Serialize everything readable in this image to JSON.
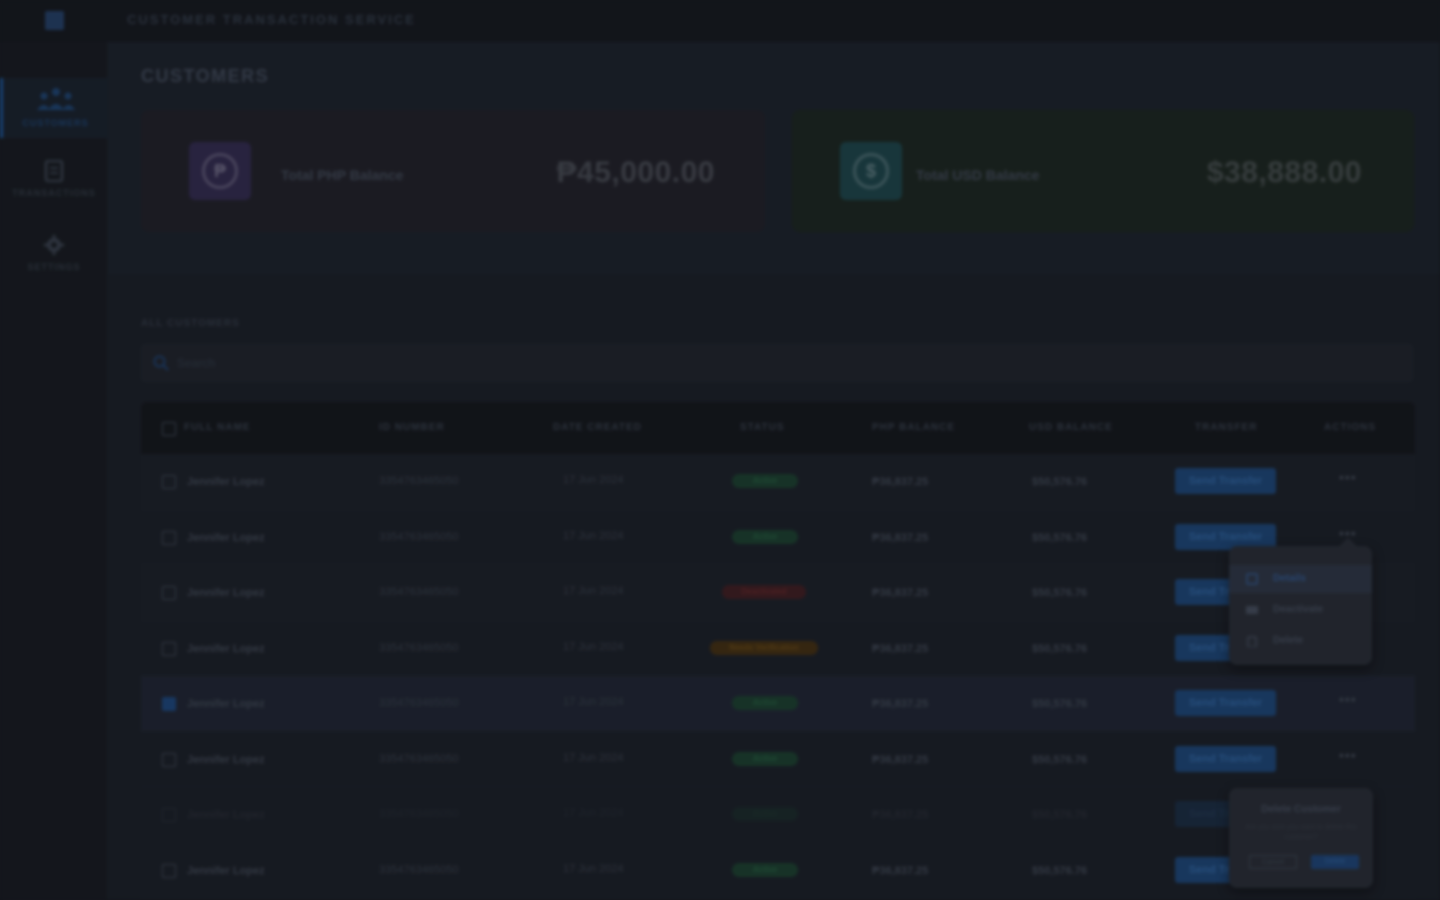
{
  "app": {
    "title": "CUSTOMER TRANSACTION SERVICE"
  },
  "sidebar": {
    "items": [
      {
        "label": "CUSTOMERS",
        "icon": "users-icon",
        "active": true
      },
      {
        "label": "TRANSACTIONS",
        "icon": "receipt-icon",
        "active": false
      },
      {
        "label": "SETTINGS",
        "icon": "gear-icon",
        "active": false
      }
    ]
  },
  "page": {
    "title": "CUSTOMERS"
  },
  "summary": {
    "php": {
      "label": "Total PHP Balance",
      "amount": "₱45,000.00",
      "symbol": "₱"
    },
    "usd": {
      "label": "Total USD Balance",
      "amount": "$38,888.00",
      "symbol": "$"
    }
  },
  "customers": {
    "section_label": "ALL CUSTOMERS",
    "search_placeholder": "Search",
    "columns": [
      "FULL NAME",
      "ID NUMBER",
      "DATE CREATED",
      "STATUS",
      "PHP BALANCE",
      "USD BALANCE",
      "TRANSFER",
      "ACTIONS"
    ],
    "rows": [
      {
        "name": "Jennifer Lopez",
        "id": "3354763465050",
        "date": "17 Jun 2024",
        "status": "Active",
        "status_color": "green",
        "php": "₱36,837.25",
        "usd": "$50,576.76",
        "transfer": "Send Transfer",
        "checked": false
      },
      {
        "name": "Jennifer Lopez",
        "id": "3354763465050",
        "date": "17 Jun 2024",
        "status": "Active",
        "status_color": "green",
        "php": "₱36,837.25",
        "usd": "$50,576.76",
        "transfer": "Send Transfer",
        "checked": false
      },
      {
        "name": "Jennifer Lopez",
        "id": "3354763465050",
        "date": "17 Jun 2024",
        "status": "Deactivated",
        "status_color": "red",
        "php": "₱36,837.25",
        "usd": "$50,576.76",
        "transfer": "Send Transfer",
        "checked": false
      },
      {
        "name": "Jennifer Lopez",
        "id": "3354763465050",
        "date": "17 Jun 2024",
        "status": "Needs Verification",
        "status_color": "orange",
        "php": "₱36,837.25",
        "usd": "$50,576.76",
        "transfer": "Send Transfer",
        "checked": false
      },
      {
        "name": "Jennifer Lopez",
        "id": "3354763465050",
        "date": "17 Jun 2024",
        "status": "Active",
        "status_color": "green",
        "php": "₱36,837.25",
        "usd": "$50,576.76",
        "transfer": "Send Transfer",
        "checked": true
      },
      {
        "name": "Jennifer Lopez",
        "id": "3354763465050",
        "date": "17 Jun 2024",
        "status": "Active",
        "status_color": "green",
        "php": "₱36,837.25",
        "usd": "$50,576.76",
        "transfer": "Send Transfer",
        "checked": false
      },
      {
        "name": "Jennifer Lopez",
        "id": "3354763465050",
        "date": "17 Jun 2024",
        "status": "Active",
        "status_color": "green",
        "php": "₱36,837.25",
        "usd": "$50,576.76",
        "transfer": "Send Transfer",
        "checked": false,
        "dimmed": true
      },
      {
        "name": "Jennifer Lopez",
        "id": "3354763465050",
        "date": "17 Jun 2024",
        "status": "Active",
        "status_color": "green",
        "php": "₱36,837.25",
        "usd": "$50,576.76",
        "transfer": "Send Transfer",
        "checked": false
      }
    ],
    "actions_glyph": "•••"
  },
  "row_menu": {
    "items": [
      {
        "label": "Details",
        "icon": "details-icon",
        "highlighted": true
      },
      {
        "label": "Deactivate",
        "icon": "deactivate-icon",
        "highlighted": false
      },
      {
        "label": "Delete",
        "icon": "trash-icon",
        "highlighted": false
      }
    ]
  },
  "delete_confirm": {
    "title": "Delete Customer",
    "message": "Are you sure you want to delete this customer?",
    "cancel_label": "Cancel",
    "delete_label": "Delete"
  },
  "colors": {
    "accent": "#1d4d86",
    "active_status": "#23543c",
    "deactivated_status": "#5a2428",
    "verification_status": "#5c4216"
  }
}
